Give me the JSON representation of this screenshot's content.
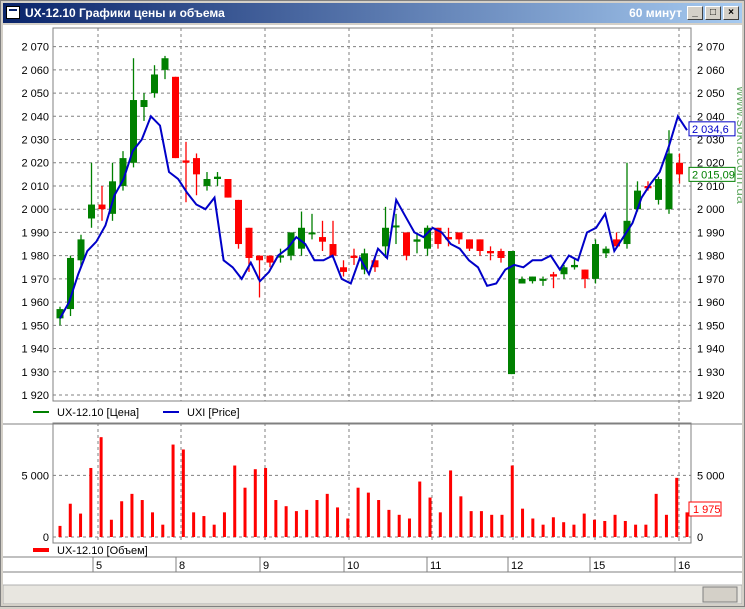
{
  "window": {
    "title": "UX-12.10 Графики цены и объема",
    "timeframe": "60 минут",
    "watermark": "www.sokra.com.ua",
    "buttons": {
      "minimize": "_",
      "maximize": "□",
      "close": "×"
    }
  },
  "colors": {
    "up": "#008000",
    "down": "#ff0000",
    "index_line": "#0000c8",
    "volume": "#ff0000",
    "grid": "#808080",
    "badge_blue": "#0000c8",
    "badge_green": "#008000",
    "badge_red": "#ff0000"
  },
  "chart_data": [
    {
      "type": "candlestick",
      "title": "",
      "ylim": [
        1920,
        2075
      ],
      "y_ticks": [
        1920,
        1930,
        1940,
        1950,
        1960,
        1970,
        1980,
        1990,
        2000,
        2010,
        2020,
        2030,
        2040,
        2050,
        2060,
        2070
      ],
      "y_tick_labels": [
        "1 920",
        "1 930",
        "1 940",
        "1 950",
        "1 960",
        "1 970",
        "1 980",
        "1 990",
        "2 000",
        "2 010",
        "2 020",
        "2 030",
        "2 040",
        "2 050",
        "2 060",
        "2 070"
      ],
      "grid": true,
      "legend_position": "bottom-left",
      "series": [
        {
          "name": "UX-12.10 [Цена]",
          "style": "candles",
          "candles": [
            [
              1953,
              1958,
              1950,
              1957
            ],
            [
              1957,
              1980,
              1954,
              1979
            ],
            [
              1978,
              1989,
              1975,
              1987
            ],
            [
              1996,
              2020,
              1992,
              2002
            ],
            [
              2002,
              2010,
              1995,
              2000
            ],
            [
              1998,
              2020,
              1995,
              2012
            ],
            [
              2010,
              2025,
              2008,
              2022
            ],
            [
              2020,
              2065,
              2018,
              2047
            ],
            [
              2044,
              2050,
              2038,
              2047
            ],
            [
              2050,
              2062,
              2048,
              2058
            ],
            [
              2060,
              2066,
              2056,
              2065
            ],
            [
              2057,
              2057,
              2022,
              2022
            ],
            [
              2021,
              2029,
              2003,
              2020
            ],
            [
              2022,
              2024,
              2006,
              2015
            ],
            [
              2010,
              2016,
              2008,
              2013
            ],
            [
              2013,
              2016,
              2010,
              2014
            ],
            [
              2013,
              2013,
              2005,
              2005
            ],
            [
              2004,
              2004,
              1983,
              1985
            ],
            [
              1992,
              1992,
              1973,
              1979
            ],
            [
              1980,
              1980,
              1962,
              1978
            ],
            [
              1980,
              1980,
              1975,
              1977
            ],
            [
              1980,
              1983,
              1977,
              1980
            ],
            [
              1980,
              1990,
              1978,
              1990
            ],
            [
              1983,
              1999,
              1980,
              1992
            ],
            [
              1990,
              1998,
              1987,
              1990
            ],
            [
              1988,
              1995,
              1982,
              1986
            ],
            [
              1985,
              1995,
              1979,
              1980
            ],
            [
              1975,
              1978,
              1971,
              1973
            ],
            [
              1980,
              1983,
              1976,
              1979
            ],
            [
              1974,
              1983,
              1972,
              1981
            ],
            [
              1978,
              1980,
              1973,
              1975
            ],
            [
              1984,
              2001,
              1979,
              1992
            ],
            [
              1993,
              1998,
              1985,
              1993
            ],
            [
              1990,
              1990,
              1978,
              1980
            ],
            [
              1986,
              1990,
              1981,
              1987
            ],
            [
              1983,
              1993,
              1980,
              1992
            ],
            [
              1992,
              1992,
              1983,
              1985
            ],
            [
              1988,
              1992,
              1984,
              1987
            ],
            [
              1990,
              1990,
              1985,
              1987
            ],
            [
              1987,
              1987,
              1982,
              1983
            ],
            [
              1987,
              1987,
              1980,
              1982
            ],
            [
              1982,
              1984,
              1978,
              1981
            ],
            [
              1982,
              1983,
              1977,
              1979
            ],
            [
              1929,
              1982,
              1929,
              1982
            ],
            [
              1968,
              1971,
              1968,
              1970
            ],
            [
              1969,
              1971,
              1968,
              1971
            ],
            [
              1970,
              1971,
              1967,
              1970
            ],
            [
              1972,
              1973,
              1966,
              1971
            ],
            [
              1972,
              1976,
              1970,
              1975
            ],
            [
              1975,
              1979,
              1974,
              1976
            ],
            [
              1974,
              1974,
              1966,
              1970
            ],
            [
              1970,
              1987,
              1968,
              1985
            ],
            [
              1981,
              1984,
              1979,
              1983
            ],
            [
              1987,
              1990,
              1984,
              1984
            ],
            [
              1985,
              2020,
              1983,
              1995
            ],
            [
              2000,
              2012,
              1999,
              2008
            ],
            [
              2010,
              2012,
              2008,
              2009
            ],
            [
              2004,
              2014,
              2002,
              2013
            ],
            [
              2000,
              2034,
              1998,
              2024
            ],
            [
              2020,
              2024,
              2011,
              2015
            ]
          ]
        },
        {
          "name": "UXI [Price]",
          "style": "line",
          "values": [
            1953,
            1960,
            1972,
            1982,
            1986,
            1993,
            2006,
            2013,
            2025,
            2030,
            2040,
            2036,
            2016,
            2013,
            2007,
            2002,
            2000,
            2005,
            1978,
            1975,
            1970,
            1977,
            1969,
            1973,
            1980,
            1983,
            1988,
            1985,
            1978,
            1978,
            1980,
            1970,
            1968,
            1979,
            1972,
            1983,
            1979,
            2004,
            1997,
            1990,
            1988,
            1992,
            1990,
            1985,
            1983,
            1978,
            1975,
            1967,
            1968,
            1974,
            1976,
            1975,
            1978,
            1978,
            1980,
            1974,
            1980,
            1978,
            1990,
            1992,
            1998,
            1982,
            1988,
            1994,
            2005,
            2011,
            2016,
            2027,
            2040,
            2034
          ]
        }
      ],
      "price_badges": [
        {
          "series": "UXI [Price]",
          "label": "2 034,6",
          "value": 2034.6
        },
        {
          "series": "UX-12.10 [Цена]",
          "label": "2 015,09",
          "value": 2015
        }
      ]
    },
    {
      "type": "bar",
      "title": "",
      "ylim": [
        0,
        8600
      ],
      "y_ticks": [
        0,
        5000
      ],
      "y_tick_labels": [
        "0",
        "5 000"
      ],
      "grid": true,
      "x_tick_labels": [
        "5",
        "8",
        "9",
        "10",
        "11",
        "12",
        "15",
        "16"
      ],
      "series": [
        {
          "name": "UX-12.10 [Объем]",
          "values": [
            900,
            2700,
            1900,
            5600,
            8100,
            1400,
            2900,
            3500,
            3000,
            2000,
            1000,
            7500,
            7100,
            2000,
            1700,
            1000,
            2000,
            5800,
            4000,
            5500,
            5600,
            3000,
            2500,
            2100,
            2200,
            3000,
            3500,
            2400,
            1500,
            4000,
            3600,
            3000,
            2200,
            1800,
            1500,
            4500,
            3200,
            2000,
            5400,
            3300,
            2100,
            2100,
            1800,
            1800,
            5800,
            2300,
            1500,
            1000,
            1600,
            1200,
            1000,
            1900,
            1400,
            1300,
            1800,
            1300,
            1000,
            1000,
            3500,
            1800,
            4800,
            2000
          ]
        }
      ],
      "value_badge": {
        "label": "1 975",
        "value": 1975
      }
    }
  ]
}
